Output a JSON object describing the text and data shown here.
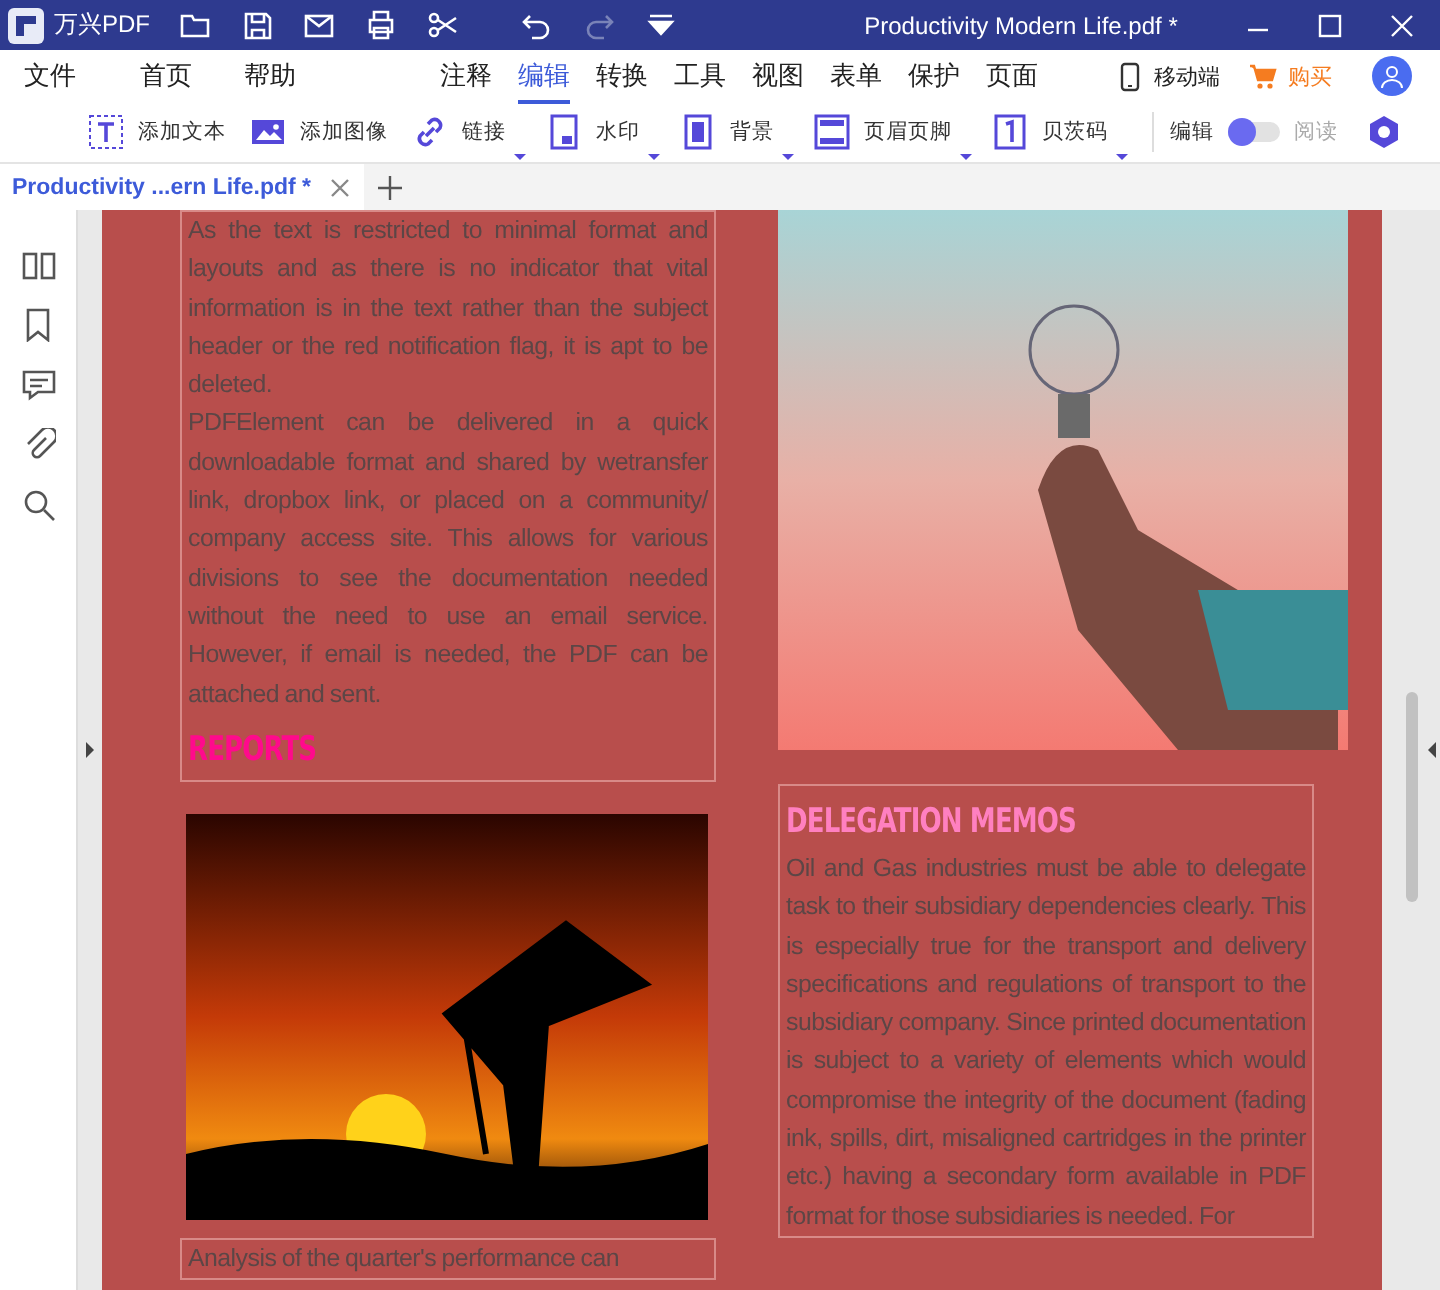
{
  "app": {
    "name": "万兴PDF"
  },
  "window": {
    "title": "Productivity Modern Life.pdf *"
  },
  "menu": {
    "left": [
      "文件",
      "首页",
      "帮助"
    ],
    "tabs": [
      {
        "label": "注释",
        "selected": false
      },
      {
        "label": "编辑",
        "selected": true
      },
      {
        "label": "转换",
        "selected": false
      },
      {
        "label": "工具",
        "selected": false
      },
      {
        "label": "视图",
        "selected": false
      },
      {
        "label": "表单",
        "selected": false
      },
      {
        "label": "保护",
        "selected": false
      },
      {
        "label": "页面",
        "selected": false
      }
    ],
    "right": [
      {
        "label": "移动端",
        "kind": "phone"
      },
      {
        "label": "购买",
        "kind": "cart"
      }
    ]
  },
  "toolbar": {
    "tools": [
      {
        "label": "添加文本",
        "dropdown": false
      },
      {
        "label": "添加图像",
        "dropdown": false
      },
      {
        "label": "链接",
        "dropdown": true
      },
      {
        "label": "水印",
        "dropdown": true
      },
      {
        "label": "背景",
        "dropdown": true
      },
      {
        "label": "页眉页脚",
        "dropdown": true
      },
      {
        "label": "贝茨码",
        "dropdown": true
      }
    ],
    "mode": {
      "edit_label": "编辑",
      "read_label": "阅读",
      "read_mode": false
    }
  },
  "doc_tabs": [
    {
      "label": "Productivity ...ern Life.pdf *",
      "selected": true
    }
  ],
  "document": {
    "left": [
      {
        "kind": "textbox",
        "items": [
          {
            "kind": "paragraph",
            "text": "As the text is restricted to minimal format and layouts and as there is no indicator that vital information is in the text rather than the subject header or the red notification flag, it is apt to be deleted."
          },
          {
            "kind": "paragraph",
            "text": "PDFElement can be delivered in a quick downloadable format and shared by wetransfer link, dropbox link, or placed on a community/ company access site. This allows for various divisions to see the documentation needed without the need to use an email service. However, if email is needed, the PDF can be attached and sent."
          },
          {
            "kind": "heading",
            "text": "REPORTS",
            "color": "#ff0a8c"
          }
        ]
      },
      {
        "kind": "photo"
      },
      {
        "kind": "textbox",
        "items": [
          {
            "kind": "paragraph",
            "text": "Analysis of the quarter's performance can"
          }
        ]
      }
    ],
    "right": [
      {
        "kind": "photo"
      },
      {
        "kind": "textbox",
        "items": [
          {
            "kind": "heading",
            "text": "DELEGATION MEMOS",
            "color": "#ff80c0"
          },
          {
            "kind": "paragraph",
            "text": "Oil and Gas industries must be able to delegate task to their subsidiary dependencies clearly. This is especially true for the transport and delivery specifications and regulations of transport to the subsidiary company. Since printed documentation is subject to a variety of elements which would compromise the integrity of the document (fading ink, spills, dirt, misaligned cartridges in the printer etc.) having a secondary form available in PDF format for those subsidiaries is needed. For"
          }
        ]
      }
    ]
  }
}
